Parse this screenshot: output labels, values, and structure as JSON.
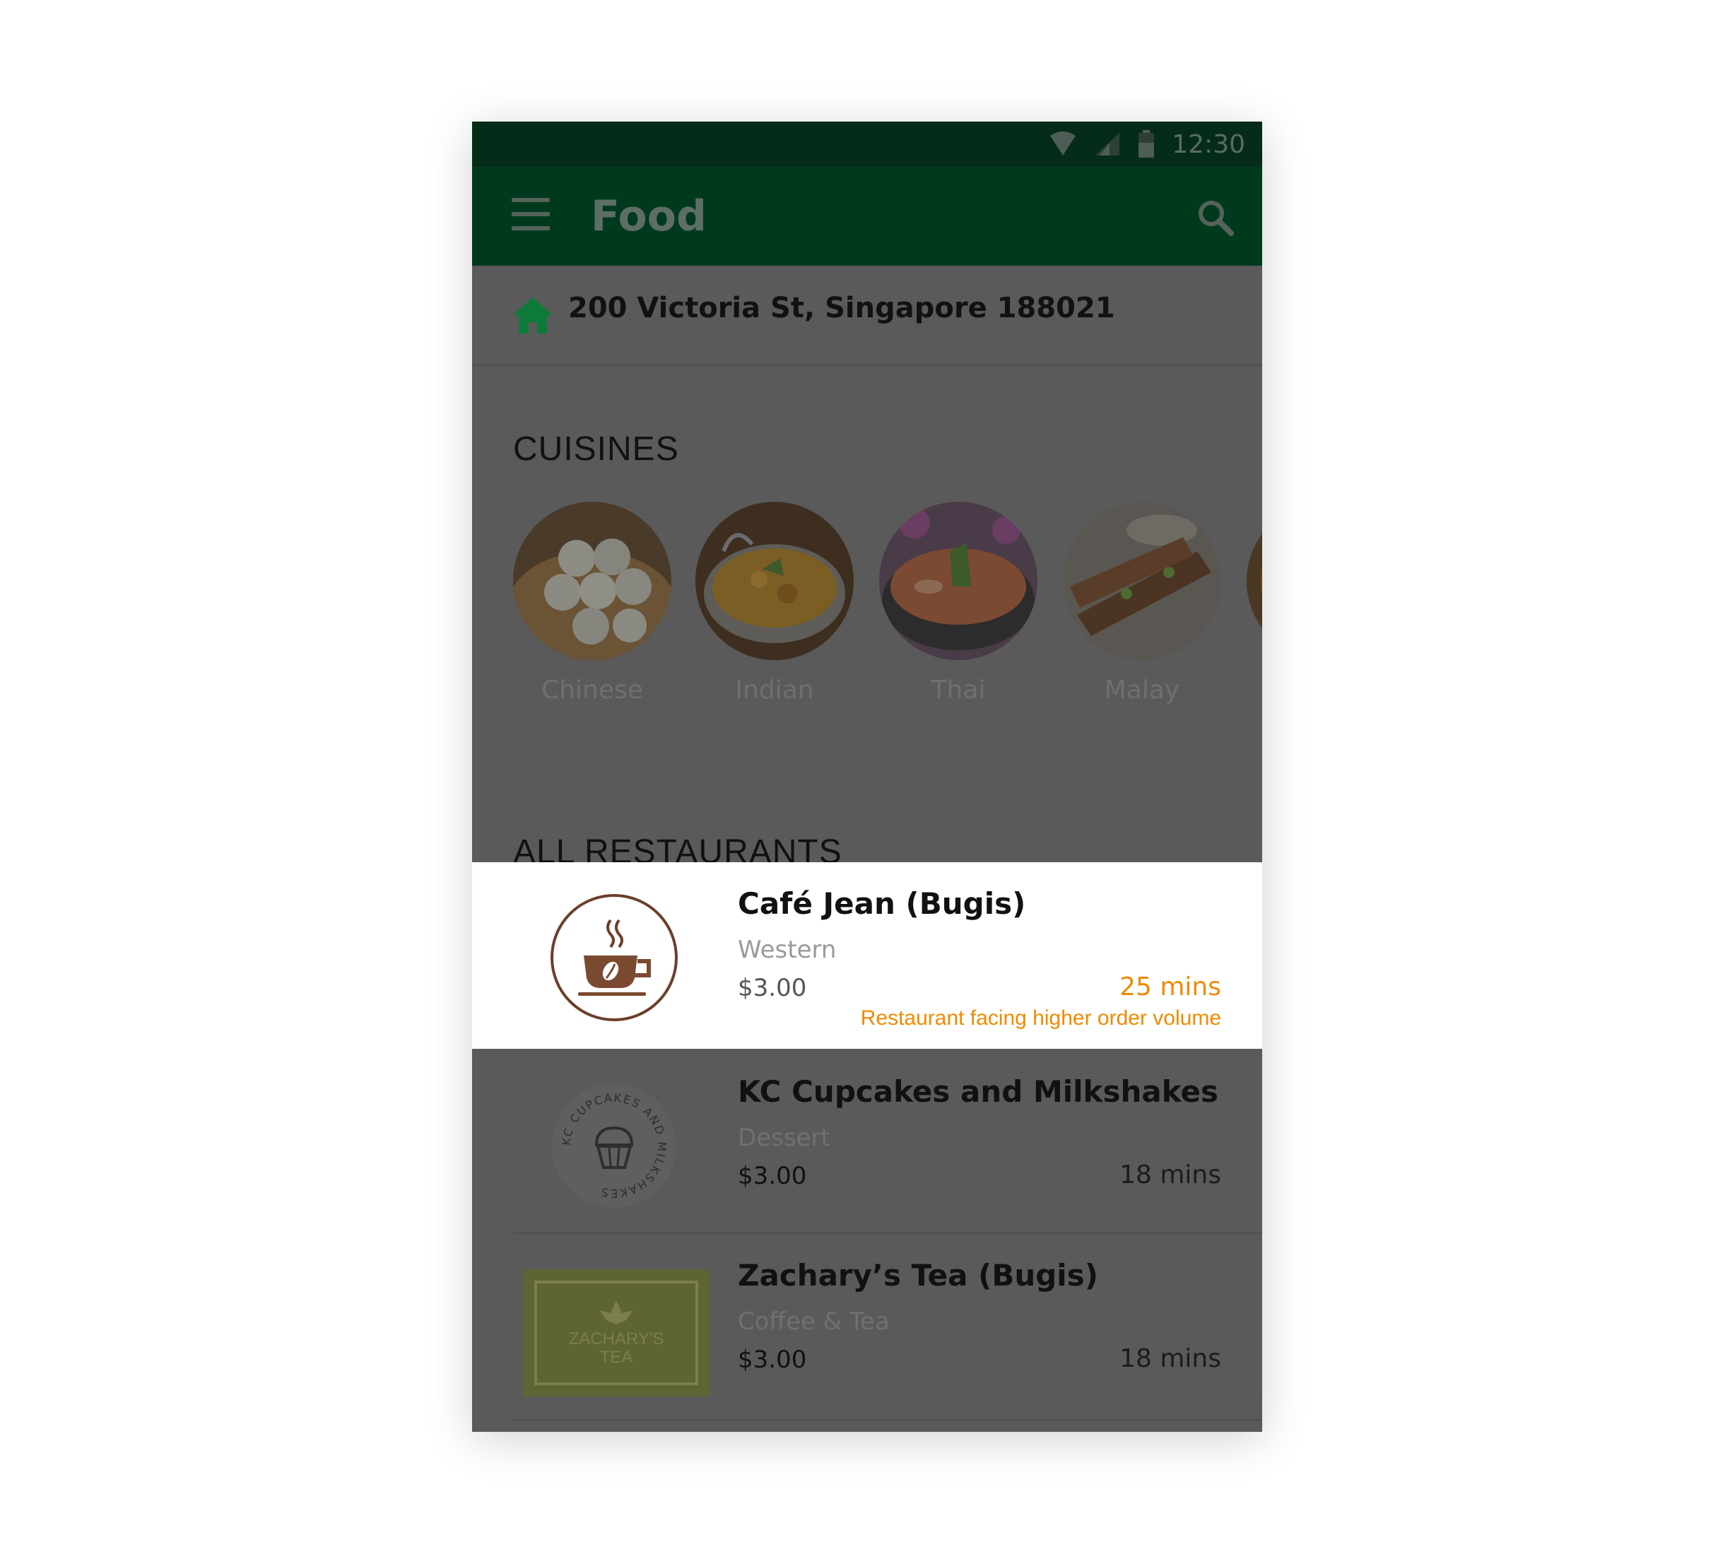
{
  "status_bar": {
    "time": "12:30"
  },
  "app_bar": {
    "title": "Food"
  },
  "address": {
    "text": "200 Victoria St, Singapore 188021"
  },
  "cuisines": {
    "title": "CUISINES",
    "items": [
      {
        "label": "Chinese"
      },
      {
        "label": "Indian"
      },
      {
        "label": "Thai"
      },
      {
        "label": "Malay"
      }
    ]
  },
  "restaurants": {
    "title": "ALL RESTAURANTS",
    "items": [
      {
        "name": "Café Jean (Bugis)",
        "cuisine": "Western",
        "price": "$3.00",
        "eta": "25 mins",
        "notice": "Restaurant facing higher order volume"
      },
      {
        "name": "KC Cupcakes and Milkshakes",
        "cuisine": "Dessert",
        "price": "$3.00",
        "eta": "18 mins",
        "logo_text": "KC CUPCAKES AND MILKSHAKES"
      },
      {
        "name": "Zachary’s Tea (Bugis)",
        "cuisine": "Coffee & Tea",
        "price": "$3.00",
        "eta": "18 mins",
        "logo_text_line1": "ZACHARY'S",
        "logo_text_line2": "TEA"
      }
    ]
  },
  "colors": {
    "brand_green": "#003a1e",
    "accent_orange": "#f08a00",
    "overlay": "#5a5a5a"
  }
}
